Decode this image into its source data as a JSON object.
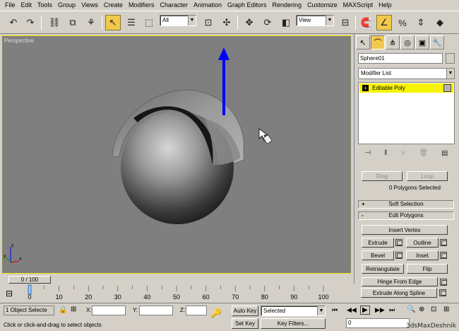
{
  "menu": [
    "File",
    "Edit",
    "Tools",
    "Group",
    "Views",
    "Create",
    "Modifiers",
    "Character",
    "Animation",
    "Graph Editors",
    "Rendering",
    "Customize",
    "MAXScript",
    "Help"
  ],
  "toolbar": {
    "selection_filter": "All",
    "ref_coord": "View"
  },
  "viewport": {
    "label": "Perspective",
    "axis_x": "x",
    "axis_y": "y",
    "axis_z": "z"
  },
  "panel": {
    "object_name": "Sphere01",
    "modifier_list": "Modifier List",
    "stack_item": "Editable Poly",
    "ring": "Ring",
    "loop": "Loop",
    "polygons_selected": "0 Polygons Selected",
    "soft_selection": "Soft Selection",
    "edit_polygons": "Edit Polygons",
    "insert_vertex": "Insert Vertex",
    "extrude": "Extrude",
    "outline": "Outline",
    "bevel": "Bevel",
    "inset": "Inset",
    "retriangulate": "Retriangulate",
    "flip": "Flip",
    "hinge_from_edge": "Hinge From Edge",
    "extrude_along_spline": "Extrude Along Spline"
  },
  "timeline": {
    "frame_display": "0 / 100",
    "ticks": [
      "0",
      "10",
      "20",
      "30",
      "40",
      "50",
      "60",
      "70",
      "80",
      "90",
      "100"
    ]
  },
  "status": {
    "selection_count": "1 Object Selecte",
    "prompt": "Click or click-and-drag to select objects",
    "x_label": "X:",
    "y_label": "Y:",
    "z_label": "Z:",
    "auto_key": "Auto Key",
    "set_key": "Set Key",
    "key_mode": "Selected",
    "key_filters": "Key Filters...",
    "current_frame": "0"
  },
  "watermark": "3dsMaxDeshnik",
  "colors": {
    "viewport_bg": "#7f7f7f",
    "active_border": "#f2e600",
    "gizmo_blue": "#0000ff",
    "stack_highlight": "#f7f300"
  }
}
